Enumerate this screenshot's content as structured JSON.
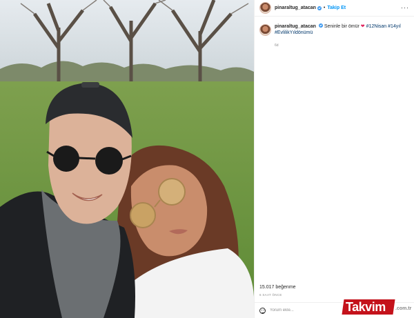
{
  "post": {
    "username": "pinaraltug_atacan",
    "follow_label": "Takip Et",
    "more_icon": "more-horizontal-icon",
    "caption": {
      "text_before": "Seninle bir ömür",
      "heart": "❤",
      "hashtags_line1": "#12Nisan #14yıl",
      "hashtags_line2": "#EvlilikYıldönümü",
      "time": "6d"
    },
    "likes": "15.017 beğenme",
    "date": "6 SAAT ÖNCE",
    "comment": {
      "placeholder": "Yorum ekle..."
    }
  },
  "watermark": {
    "brand": "Takvim",
    "domain": ".com.tr"
  },
  "colors": {
    "accent": "#0095f6",
    "heart": "#e0245e",
    "hashtag": "#00376b",
    "watermark": "#c4121b"
  }
}
